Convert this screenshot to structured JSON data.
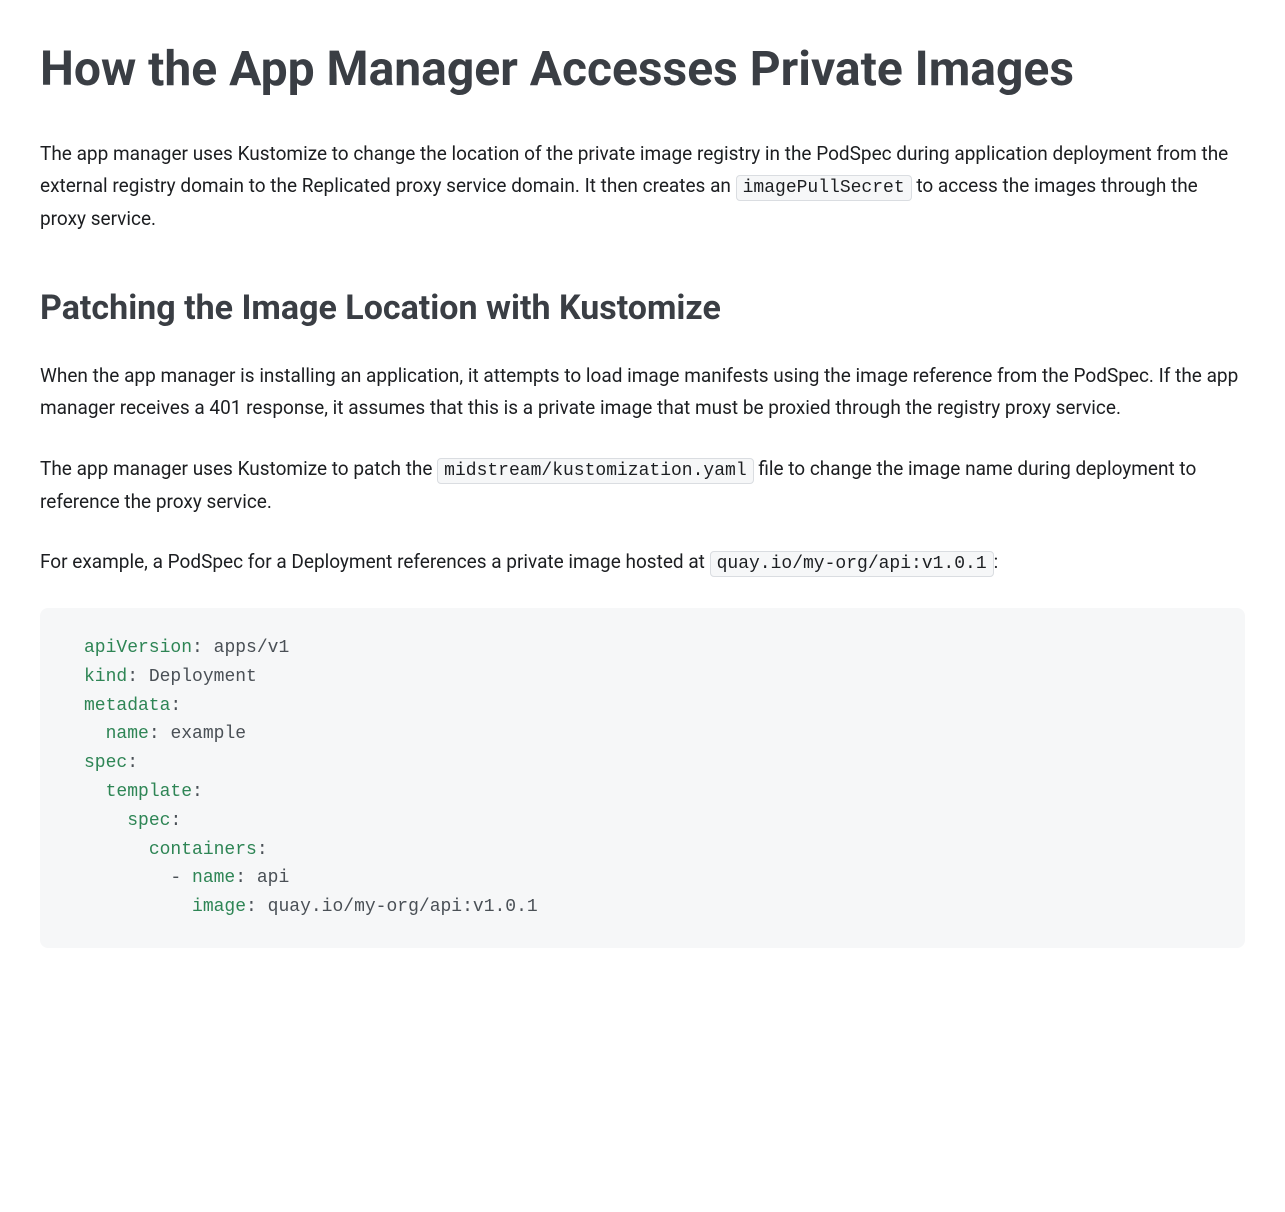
{
  "h1": "How the App Manager Accesses Private Images",
  "p1_a": "The app manager uses Kustomize to change the location of the private image registry in the PodSpec during application deployment from the external registry domain to the Replicated proxy service domain. It then creates an ",
  "p1_code": "imagePullSecret",
  "p1_b": " to access the images through the proxy service.",
  "h2": "Patching the Image Location with Kustomize",
  "p2": "When the app manager is installing an application, it attempts to load image manifests using the image reference from the PodSpec. If the app manager receives a 401 response, it assumes that this is a private image that must be proxied through the registry proxy service.",
  "p3_a": "The app manager uses Kustomize to patch the ",
  "p3_code": "midstream/kustomization.yaml",
  "p3_b": " file to change the image name during deployment to reference the proxy service.",
  "p4_a": "For example, a PodSpec for a Deployment references a private image hosted at ",
  "p4_code": "quay.io/my-org/api:v1.0.1",
  "p4_b": ":",
  "code": {
    "lines": [
      {
        "indent": "",
        "key": "apiVersion",
        "punc": ":",
        "val": " apps/v1"
      },
      {
        "indent": "",
        "key": "kind",
        "punc": ":",
        "val": " Deployment"
      },
      {
        "indent": "",
        "key": "metadata",
        "punc": ":",
        "val": ""
      },
      {
        "indent": "  ",
        "key": "name",
        "punc": ":",
        "val": " example"
      },
      {
        "indent": "",
        "key": "spec",
        "punc": ":",
        "val": ""
      },
      {
        "indent": "  ",
        "key": "template",
        "punc": ":",
        "val": ""
      },
      {
        "indent": "    ",
        "key": "spec",
        "punc": ":",
        "val": ""
      },
      {
        "indent": "      ",
        "key": "containers",
        "punc": ":",
        "val": ""
      },
      {
        "indent": "        ",
        "dash": "- ",
        "key": "name",
        "punc": ":",
        "val": " api"
      },
      {
        "indent": "          ",
        "key": "image",
        "punc": ":",
        "val": " quay.io/my-org/api:v1.0.1"
      }
    ]
  }
}
